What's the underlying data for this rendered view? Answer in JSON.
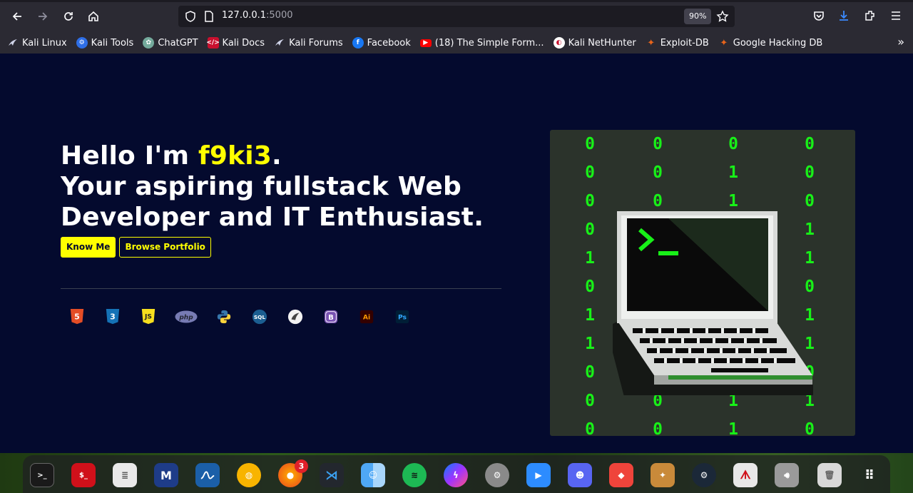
{
  "browser": {
    "url_host": "127.0.0.1",
    "url_port": ":5000",
    "zoom": "90%",
    "bookmarks": [
      {
        "label": "Kali Linux",
        "icon": "kali-dragon-icon"
      },
      {
        "label": "Kali Tools",
        "icon": "kali-tools-icon"
      },
      {
        "label": "ChatGPT",
        "icon": "chatgpt-icon"
      },
      {
        "label": "Kali Docs",
        "icon": "kali-docs-icon"
      },
      {
        "label": "Kali Forums",
        "icon": "kali-dragon-icon"
      },
      {
        "label": "Facebook",
        "icon": "facebook-icon"
      },
      {
        "label": "(18) The Simple Form...",
        "icon": "youtube-icon"
      },
      {
        "label": "Kali NetHunter",
        "icon": "nethunter-icon"
      },
      {
        "label": "Exploit-DB",
        "icon": "exploitdb-icon"
      },
      {
        "label": "Google Hacking DB",
        "icon": "exploitdb-icon"
      }
    ]
  },
  "hero": {
    "greeting": "Hello I'm ",
    "name": "f9ki3",
    "period": ".",
    "line2": "Your aspiring fullstack Web",
    "line3": "Developer and IT Enthusiast.",
    "know_me": "Know Me",
    "browse_portfolio": "Browse Portfolio"
  },
  "skills": [
    {
      "icon": "html5-icon",
      "text": "5",
      "color": "#e44d26"
    },
    {
      "icon": "css3-icon",
      "text": "3",
      "color": "#1572b6"
    },
    {
      "icon": "javascript-icon",
      "text": "JS",
      "color": "#f7df1e"
    },
    {
      "icon": "php-icon",
      "text": "php",
      "color": "#777bb3"
    },
    {
      "icon": "python-icon",
      "text": "",
      "color": "#3776ab"
    },
    {
      "icon": "sql-icon",
      "text": "SQL",
      "color": "#1b5e91"
    },
    {
      "icon": "mysql-icon",
      "text": "",
      "color": "#ffffff"
    },
    {
      "icon": "bootstrap-icon",
      "text": "B",
      "color": "#7952b3"
    },
    {
      "icon": "illustrator-icon",
      "text": "Ai",
      "color": "#ff9a00"
    },
    {
      "icon": "photoshop-icon",
      "text": "Ps",
      "color": "#31a8ff"
    }
  ],
  "matrix_columns": [
    [
      "0",
      "0",
      "0",
      "0",
      "1",
      "0",
      "1",
      "1",
      "0",
      "0",
      "0"
    ],
    [
      "0",
      "0",
      "0",
      "",
      "",
      "",
      "",
      "",
      "",
      "0",
      "0"
    ],
    [
      "0",
      "1",
      "1",
      "",
      "",
      "",
      "",
      "",
      "",
      "1",
      "1"
    ],
    [
      "0",
      "0",
      "0",
      "1",
      "1",
      "0",
      "1",
      "1",
      "0",
      "1",
      "0"
    ]
  ],
  "dock": {
    "firefox_badge": "3",
    "apps": [
      "terminal-icon",
      "root-terminal-icon",
      "text-editor-icon",
      "metasploit-icon",
      "wireshark-icon",
      "orange-icon",
      "firefox-icon",
      "vscode-icon",
      "finder-icon",
      "spotify-icon",
      "messenger-icon",
      "settings-icon",
      "zoom-icon",
      "discord-icon",
      "anydesk-icon",
      "stardew-icon",
      "steam-icon",
      "acrobat-icon",
      "volume-icon",
      "trash-icon",
      "app-grid-icon"
    ]
  }
}
